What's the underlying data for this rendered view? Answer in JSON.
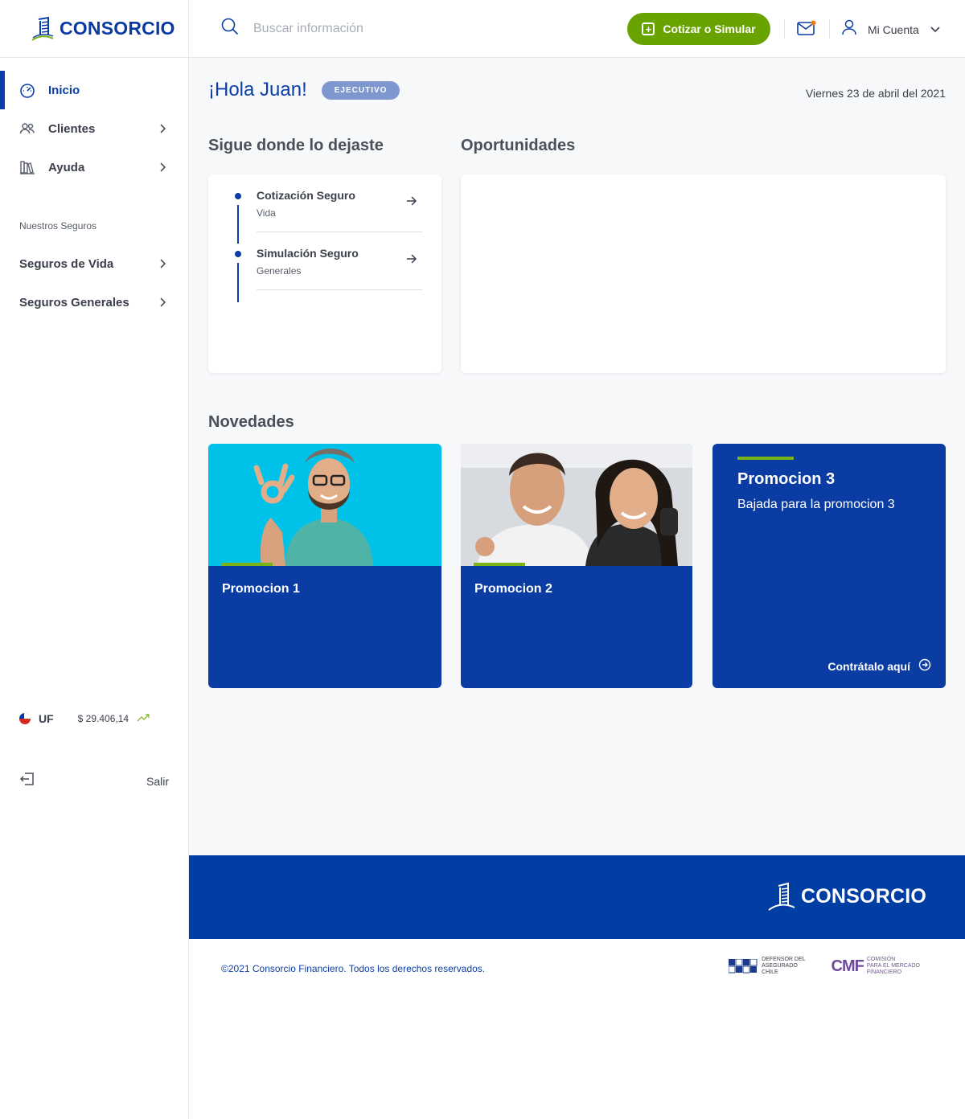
{
  "brand": {
    "name": "CONSORCIO",
    "primary": "#0b3ea8",
    "accent": "#69a300"
  },
  "sidebar": {
    "nav": [
      {
        "label": "Inicio",
        "icon": "dashboard-icon",
        "active": true
      },
      {
        "label": "Clientes",
        "icon": "users-icon"
      },
      {
        "label": "Ayuda",
        "icon": "books-icon"
      }
    ],
    "section_title": "Nuestros Seguros",
    "seguros": [
      {
        "label": "Seguros de Vida"
      },
      {
        "label": "Seguros Generales"
      }
    ],
    "uf": {
      "label": "UF",
      "value": "$ 29.406,14"
    },
    "logout": {
      "label": "Salir"
    }
  },
  "header": {
    "search_placeholder": "Buscar información",
    "cta_label": "Cotizar o Simular",
    "account_label": "Mi Cuenta"
  },
  "main": {
    "greeting": "¡Hola Juan!",
    "role_badge": "EJECUTIVO",
    "date": "Viernes 23 de abril del 2021",
    "resume_title": "Sigue donde lo dejaste",
    "resume_items": [
      {
        "title": "Cotización Seguro",
        "subtitle": "Vida"
      },
      {
        "title": "Simulación Seguro",
        "subtitle": "Generales"
      }
    ],
    "opportunities_title": "Oportunidades",
    "news_title": "Novedades",
    "promos": [
      {
        "title": "Promocion 1"
      },
      {
        "title": "Promocion 2"
      },
      {
        "title": "Promocion 3",
        "subtitle": "Bajada para la promocion 3",
        "link": "Contrátalo aquí"
      }
    ]
  },
  "footer": {
    "logo_text": "CONSORCIO",
    "copyright": "©2021 Consorcio Financiero.  Todos los derechos reservados.",
    "defensor_line1": "DEFENSOR DEL",
    "defensor_line2": "ASEGURADO",
    "defensor_line3": "CHILE",
    "cmf_logo": "CMF",
    "cmf_line1": "COMISIÓN",
    "cmf_line2": "PARA EL MERCADO",
    "cmf_line3": "FINANCIERO"
  }
}
